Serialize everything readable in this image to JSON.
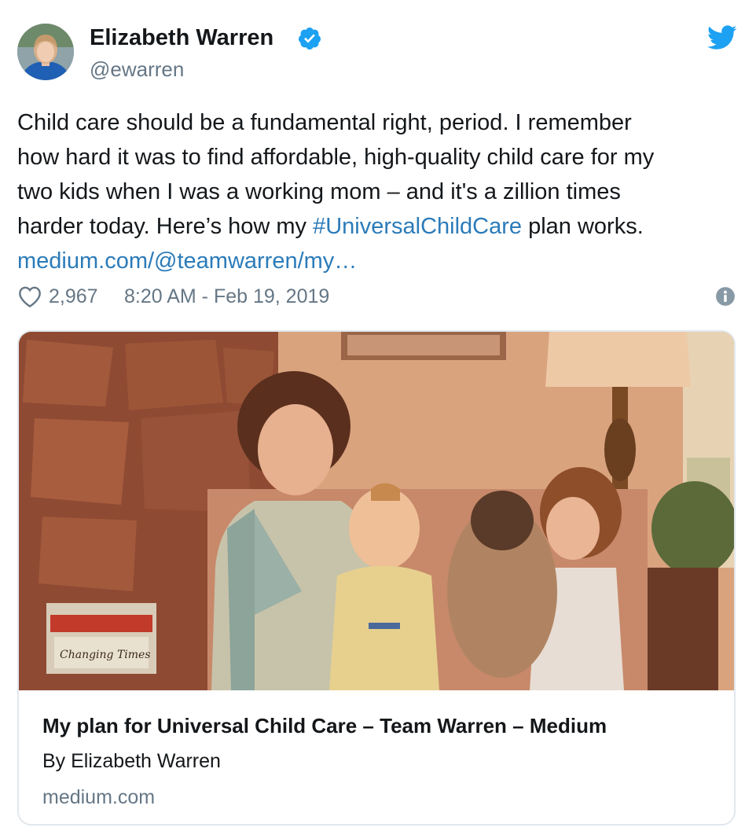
{
  "author": {
    "name": "Elizabeth Warren",
    "handle": "@ewarren",
    "verified": true,
    "avatar_icon": "profile-photo"
  },
  "tweet": {
    "lines": [
      "Child care should be a fundamental right, period. I remember",
      "how hard it was to find affordable, high-quality child care for my",
      "two kids when I was a working mom – and it's a zillion times"
    ],
    "line4_prefix": "harder today. Here’s how my ",
    "hashtag": "#UniversalChildCare",
    "line4_suffix": " plan works.",
    "link_text": "medium.com/@teamwarren/my…"
  },
  "meta": {
    "likes": "2,967",
    "timestamp": "8:20 AM - Feb 19, 2019",
    "like_icon": "heart-icon",
    "info_icon": "info-icon"
  },
  "card": {
    "title": "My plan for Universal Child Care – Team Warren – Medium",
    "description": "By Elizabeth Warren",
    "domain": "medium.com",
    "magazine_text": "Changing Times"
  },
  "colors": {
    "link": "#2b7bb9",
    "twitter_blue": "#1da1f2",
    "secondary_text": "#657786",
    "border": "#e1e8ed"
  }
}
